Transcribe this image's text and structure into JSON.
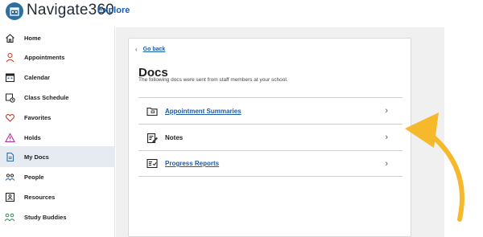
{
  "header": {
    "brand": "Navigate360",
    "explore": "Explore",
    "logo_icon": "calendar-building-icon",
    "logo_color": "#2e6f9e"
  },
  "sidebar": {
    "items": [
      {
        "label": "Home",
        "icon": "home-icon"
      },
      {
        "label": "Appointments",
        "icon": "person-icon"
      },
      {
        "label": "Calendar",
        "icon": "calendar-icon"
      },
      {
        "label": "Class Schedule",
        "icon": "class-schedule-icon"
      },
      {
        "label": "Favorites",
        "icon": "heart-icon"
      },
      {
        "label": "Holds",
        "icon": "warning-icon"
      },
      {
        "label": "My Docs",
        "icon": "document-icon",
        "active": true
      },
      {
        "label": "People",
        "icon": "people-icon"
      },
      {
        "label": "Resources",
        "icon": "resources-icon"
      },
      {
        "label": "Study Buddies",
        "icon": "study-buddies-icon"
      }
    ]
  },
  "main": {
    "go_back": "Go back",
    "title": "Docs",
    "subtitle": "The following docs were sent from staff members at your school.",
    "docs": [
      {
        "label": "Appointment Summaries",
        "icon": "folder-icon"
      },
      {
        "label": "Notes",
        "icon": "notes-icon"
      },
      {
        "label": "Progress Reports",
        "icon": "progress-report-icon"
      }
    ]
  },
  "colors": {
    "link": "#1b5aa6",
    "active_bg": "#e6eaf1",
    "arrow": "#f6b92b"
  }
}
